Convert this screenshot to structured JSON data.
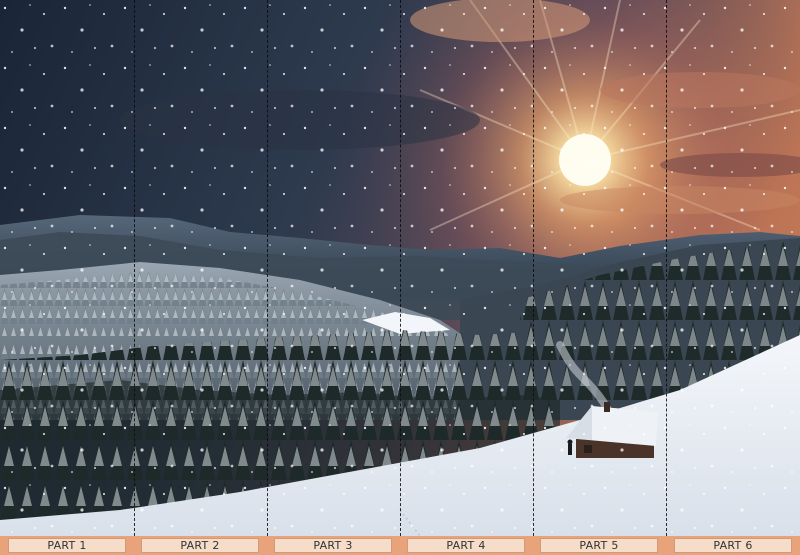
{
  "parts": [
    {
      "label": "PART 1"
    },
    {
      "label": "PART 2"
    },
    {
      "label": "PART 3"
    },
    {
      "label": "PART 4"
    },
    {
      "label": "PART 5"
    },
    {
      "label": "PART 6"
    }
  ],
  "colors": {
    "sky_top": "#1c2a3c",
    "sky_mid": "#3a4458",
    "sun_glow": "#fff6d8",
    "sunset_orange": "#e98a55",
    "snow": "#eef2f7",
    "forest_dark": "#1f2a28",
    "bar_background": "#e9a37a",
    "label_background": "#f6ddc9"
  },
  "icons": [
    "snowflake-pattern",
    "sun",
    "cabin",
    "person-silhouette"
  ]
}
